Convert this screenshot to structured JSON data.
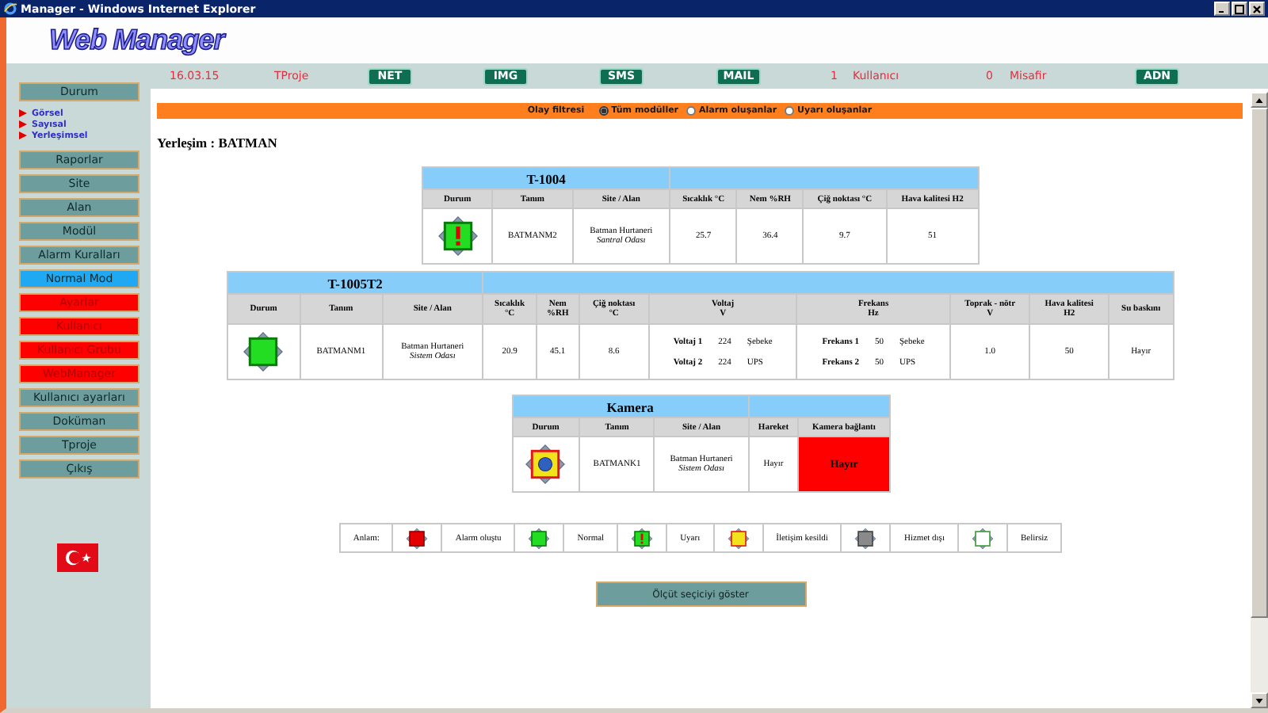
{
  "window": {
    "title": "Manager - Windows Internet Explorer"
  },
  "logo": "Web Manager",
  "top_bar": {
    "items": [
      {
        "kind": "text",
        "text": "16.03.15"
      },
      {
        "kind": "text",
        "text": "TProje"
      },
      {
        "kind": "button",
        "text": "NET"
      },
      {
        "kind": "button",
        "text": "IMG"
      },
      {
        "kind": "button",
        "text": "SMS"
      },
      {
        "kind": "button",
        "text": "MAIL"
      },
      {
        "kind": "text",
        "text": "1"
      },
      {
        "kind": "text",
        "text": "Kullanıcı"
      },
      {
        "kind": "text",
        "text": "0"
      },
      {
        "kind": "text",
        "text": "Misafir"
      },
      {
        "kind": "button",
        "text": "ADN"
      }
    ]
  },
  "sidebar": {
    "items": [
      {
        "label": "Durum",
        "kind": "menu",
        "children": [
          {
            "label": "Görsel"
          },
          {
            "label": "Sayısal"
          },
          {
            "label": "Yerleşimsel"
          }
        ]
      },
      {
        "label": "Raporlar",
        "kind": "menu"
      },
      {
        "label": "Site",
        "kind": "menu"
      },
      {
        "label": "Alan",
        "kind": "menu"
      },
      {
        "label": "Modül",
        "kind": "menu"
      },
      {
        "label": "Alarm Kuralları",
        "kind": "menu"
      },
      {
        "label": "Normal Mod",
        "kind": "mode"
      },
      {
        "label": "Ayarlar",
        "kind": "admin"
      },
      {
        "label": "Kullanıcı",
        "kind": "admin"
      },
      {
        "label": "Kullanıcı Grubu",
        "kind": "admin"
      },
      {
        "label": "WebManager",
        "kind": "admin"
      },
      {
        "label": "Kullanıcı ayarları",
        "kind": "menu"
      },
      {
        "label": "Doküman",
        "kind": "menu"
      },
      {
        "label": "Tproje",
        "kind": "menu"
      },
      {
        "label": "Çıkış",
        "kind": "menu"
      }
    ]
  },
  "filter": {
    "label": "Olay filtresi",
    "options": [
      {
        "label": "Tüm modüller",
        "selected": true
      },
      {
        "label": "Alarm oluşanlar",
        "selected": false
      },
      {
        "label": "Uyarı oluşanlar",
        "selected": false
      }
    ]
  },
  "location": "Yerleşim : BATMAN",
  "modules": [
    {
      "title": "T-1004",
      "columns": [
        [
          "Durum"
        ],
        [
          "Tanım"
        ],
        [
          "Site / Alan"
        ],
        [
          "Sıcaklık  °C"
        ],
        [
          "Nem  %RH"
        ],
        [
          "Çiğ noktası  °C"
        ],
        [
          "Hava kalitesi  H2"
        ]
      ],
      "cells": [
        {
          "kind": "status",
          "icon": {
            "kind": "warning"
          }
        },
        {
          "kind": "text",
          "text": "BATMANM2"
        },
        {
          "kind": "site",
          "lines": [
            "Batman Hurtaneri",
            "Santral Odası"
          ]
        },
        {
          "kind": "text",
          "text": "25.7"
        },
        {
          "kind": "text",
          "text": "36.4"
        },
        {
          "kind": "text",
          "text": "9.7"
        },
        {
          "kind": "text",
          "text": "51"
        }
      ]
    },
    {
      "title": "T-1005T2",
      "columns": [
        [
          "Durum"
        ],
        [
          "Tanım"
        ],
        [
          "Site / Alan"
        ],
        [
          "Sıcaklık",
          "°C"
        ],
        [
          "Nem",
          "%RH"
        ],
        [
          "Çiğ noktası",
          "°C"
        ],
        [
          "Voltaj",
          "V"
        ],
        [
          "Frekans",
          "Hz"
        ],
        [
          "Toprak - nötr",
          "V"
        ],
        [
          "Hava kalitesi",
          "H2"
        ],
        [
          "Su baskını"
        ]
      ],
      "cells": [
        {
          "kind": "status",
          "icon": {
            "kind": "normal"
          }
        },
        {
          "kind": "text",
          "text": "BATMANM1"
        },
        {
          "kind": "site",
          "lines": [
            "Batman Hurtaneri",
            "Sistem Odası"
          ]
        },
        {
          "kind": "text",
          "text": "20.9"
        },
        {
          "kind": "text",
          "text": "45.1"
        },
        {
          "kind": "text",
          "text": "8.6"
        },
        {
          "kind": "pairs",
          "readings": [
            {
              "label": "Voltaj 1",
              "value": "224",
              "source": "Şebeke"
            },
            {
              "label": "Voltaj 2",
              "value": "224",
              "source": "UPS"
            }
          ]
        },
        {
          "kind": "pairs",
          "readings": [
            {
              "label": "Frekans 1",
              "value": "50",
              "source": "Şebeke"
            },
            {
              "label": "Frekans 2",
              "value": "50",
              "source": "UPS"
            }
          ]
        },
        {
          "kind": "text",
          "text": "1.0"
        },
        {
          "kind": "text",
          "text": "50"
        },
        {
          "kind": "text",
          "text": "Hayır"
        }
      ]
    },
    {
      "title": "Kamera",
      "columns": [
        [
          "Durum"
        ],
        [
          "Tanım"
        ],
        [
          "Site / Alan"
        ],
        [
          "Hareket"
        ],
        [
          "Kamera bağlantı"
        ]
      ],
      "cells": [
        {
          "kind": "status",
          "icon": {
            "kind": "camera_lost"
          }
        },
        {
          "kind": "text",
          "text": "BATMANK1"
        },
        {
          "kind": "site",
          "lines": [
            "Batman Hurtaneri",
            "Sistem Odası"
          ]
        },
        {
          "kind": "text",
          "text": "Hayır"
        },
        {
          "kind": "alert",
          "text": "Hayır"
        }
      ]
    }
  ],
  "legend": {
    "label": "Anlam:",
    "items": [
      {
        "kind": "alarm",
        "label": "Alarm oluştu"
      },
      {
        "kind": "normal",
        "label": "Normal"
      },
      {
        "kind": "warning",
        "label": "Uyarı"
      },
      {
        "kind": "lost",
        "label": "İletişim kesildi"
      },
      {
        "kind": "offline",
        "label": "Hizmet dışı"
      },
      {
        "kind": "unknown",
        "label": "Belirsiz"
      }
    ]
  },
  "action_button": "Ölçüt seçiciyi göster"
}
